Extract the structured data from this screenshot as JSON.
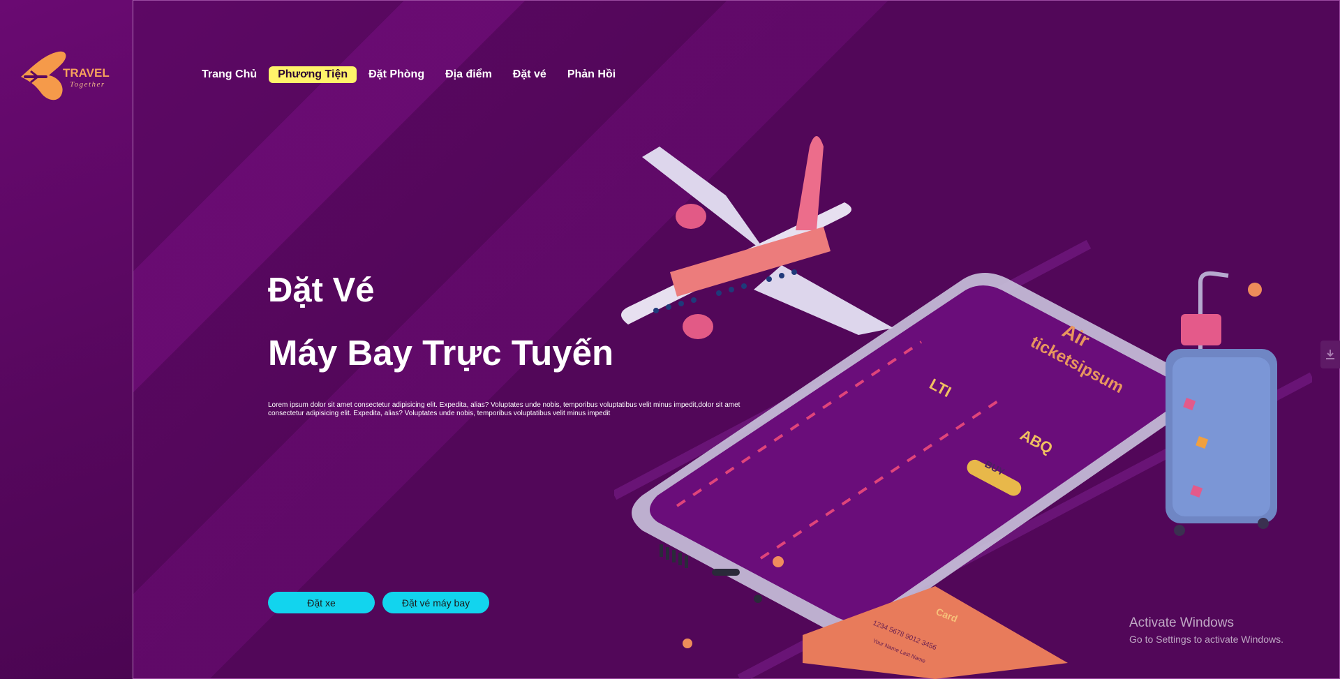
{
  "logo": {
    "brand": "TRAVEL",
    "tagline": "Together"
  },
  "nav": {
    "items": [
      {
        "label": "Trang Chủ"
      },
      {
        "label": "Phương Tiện"
      },
      {
        "label": "Đặt Phòng"
      },
      {
        "label": "Địa điểm"
      },
      {
        "label": "Đặt vé"
      },
      {
        "label": "Phản Hồi"
      }
    ],
    "active_index": 1
  },
  "hero": {
    "title_line1": "Đặt Vé",
    "title_line2": "Máy Bay Trực Tuyến",
    "description": "Lorem ipsum dolor sit amet consectetur adipisicing elit. Expedita, alias? Voluptates unde nobis, temporibus voluptatibus velit minus impedit,dolor sit amet consectetur adipisicing elit. Expedita, alias? Voluptates unde nobis, temporibus voluptatibus velit minus impedit"
  },
  "buttons": {
    "book_car": "Đặt xe",
    "book_flight": "Đặt vé máy bay"
  },
  "illustration": {
    "phone_word1": "Air",
    "phone_word2": "ticketsipsum",
    "origin_code": "LTI",
    "destination_code": "ABQ",
    "buy_label": "BUY",
    "card_label": "Card",
    "card_number": "1234 5678 9012 3456",
    "card_holder": "Your Name Last Name"
  },
  "watermark": {
    "line1": "Activate Windows",
    "line2": "Go to Settings to activate Windows."
  },
  "colors": {
    "background": "#520759",
    "accent_button": "#12d4ee",
    "active_nav": "#fff36a",
    "logo_orange": "#f59a4a"
  },
  "icons": {
    "side_tab": "download-icon"
  }
}
